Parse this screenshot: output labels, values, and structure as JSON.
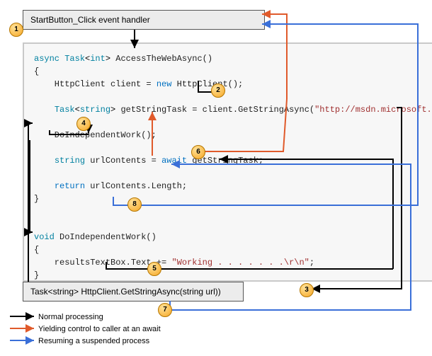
{
  "top_box": {
    "label": "StartButton_Click event handler"
  },
  "bottom_box": {
    "label": "Task<string> HttpClient.GetStringAsync(string url))"
  },
  "code": {
    "l1_async": "async",
    "l1_task": "Task",
    "l1_int": "int",
    "l1_rest": " AccessTheWebAsync()",
    "l2": "{",
    "l3_pre": "    HttpClient client = ",
    "l3_new": "new",
    "l3_post": " HttpClient();",
    "l5_task": "Task",
    "l5_str": "string",
    "l5_rest": " getStringTask = client.GetStringAsync(",
    "l5_url": "\"http://msdn.microsoft.com\"",
    "l5_end": ");",
    "l7": "    DoIndependentWork();",
    "l9_pre": "    ",
    "l9_type": "string",
    "l9_mid": " urlContents = ",
    "l9_await": "await",
    "l9_post": " getStringTask;",
    "l11_pre": "    ",
    "l11_ret": "return",
    "l11_post": " urlContents.Length;",
    "l12": "}",
    "l14_void": "void",
    "l14_rest": " DoIndependentWork()",
    "l15": "{",
    "l16_pre": "    resultsTextBox.Text += ",
    "l16_str": "\"Working . . . . . . .\\r\\n\"",
    "l16_end": ";",
    "l17": "}"
  },
  "markers": {
    "m1": "1",
    "m2": "2",
    "m3": "3",
    "m4": "4",
    "m5": "5",
    "m6": "6",
    "m7": "7",
    "m8": "8"
  },
  "legend": {
    "normal": "Normal processing",
    "yield": "Yielding control to caller at an await",
    "resume": "Resuming a suspended process"
  }
}
